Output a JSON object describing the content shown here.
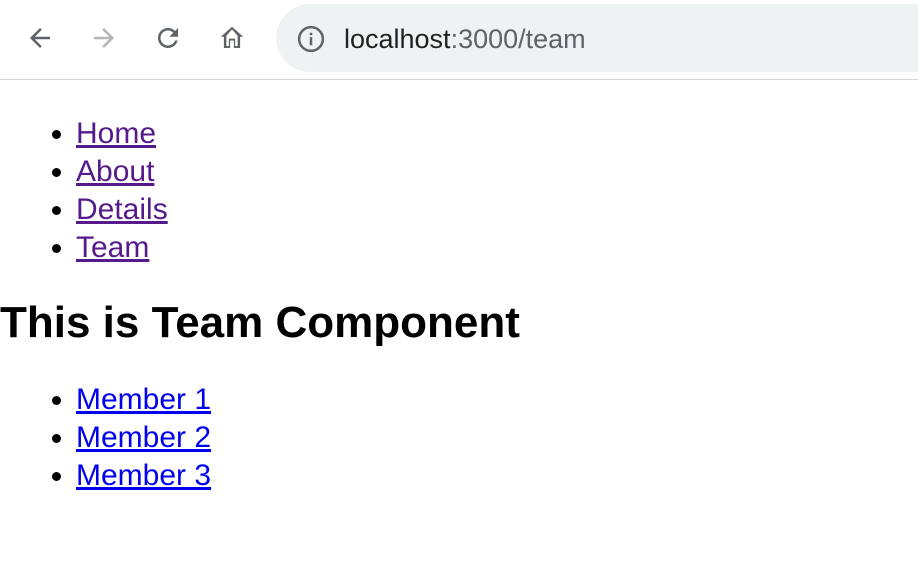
{
  "browser": {
    "url_host": "localhost",
    "url_path": ":3000/team"
  },
  "nav_links": [
    {
      "label": "Home"
    },
    {
      "label": "About"
    },
    {
      "label": "Details"
    },
    {
      "label": "Team"
    }
  ],
  "page": {
    "heading": "This is Team Component"
  },
  "members": [
    {
      "label": "Member 1"
    },
    {
      "label": "Member 2"
    },
    {
      "label": "Member 3"
    }
  ],
  "colors": {
    "visited_link": "#551a8b",
    "link": "#0000ee",
    "omnibox_bg": "#eff2f3"
  }
}
